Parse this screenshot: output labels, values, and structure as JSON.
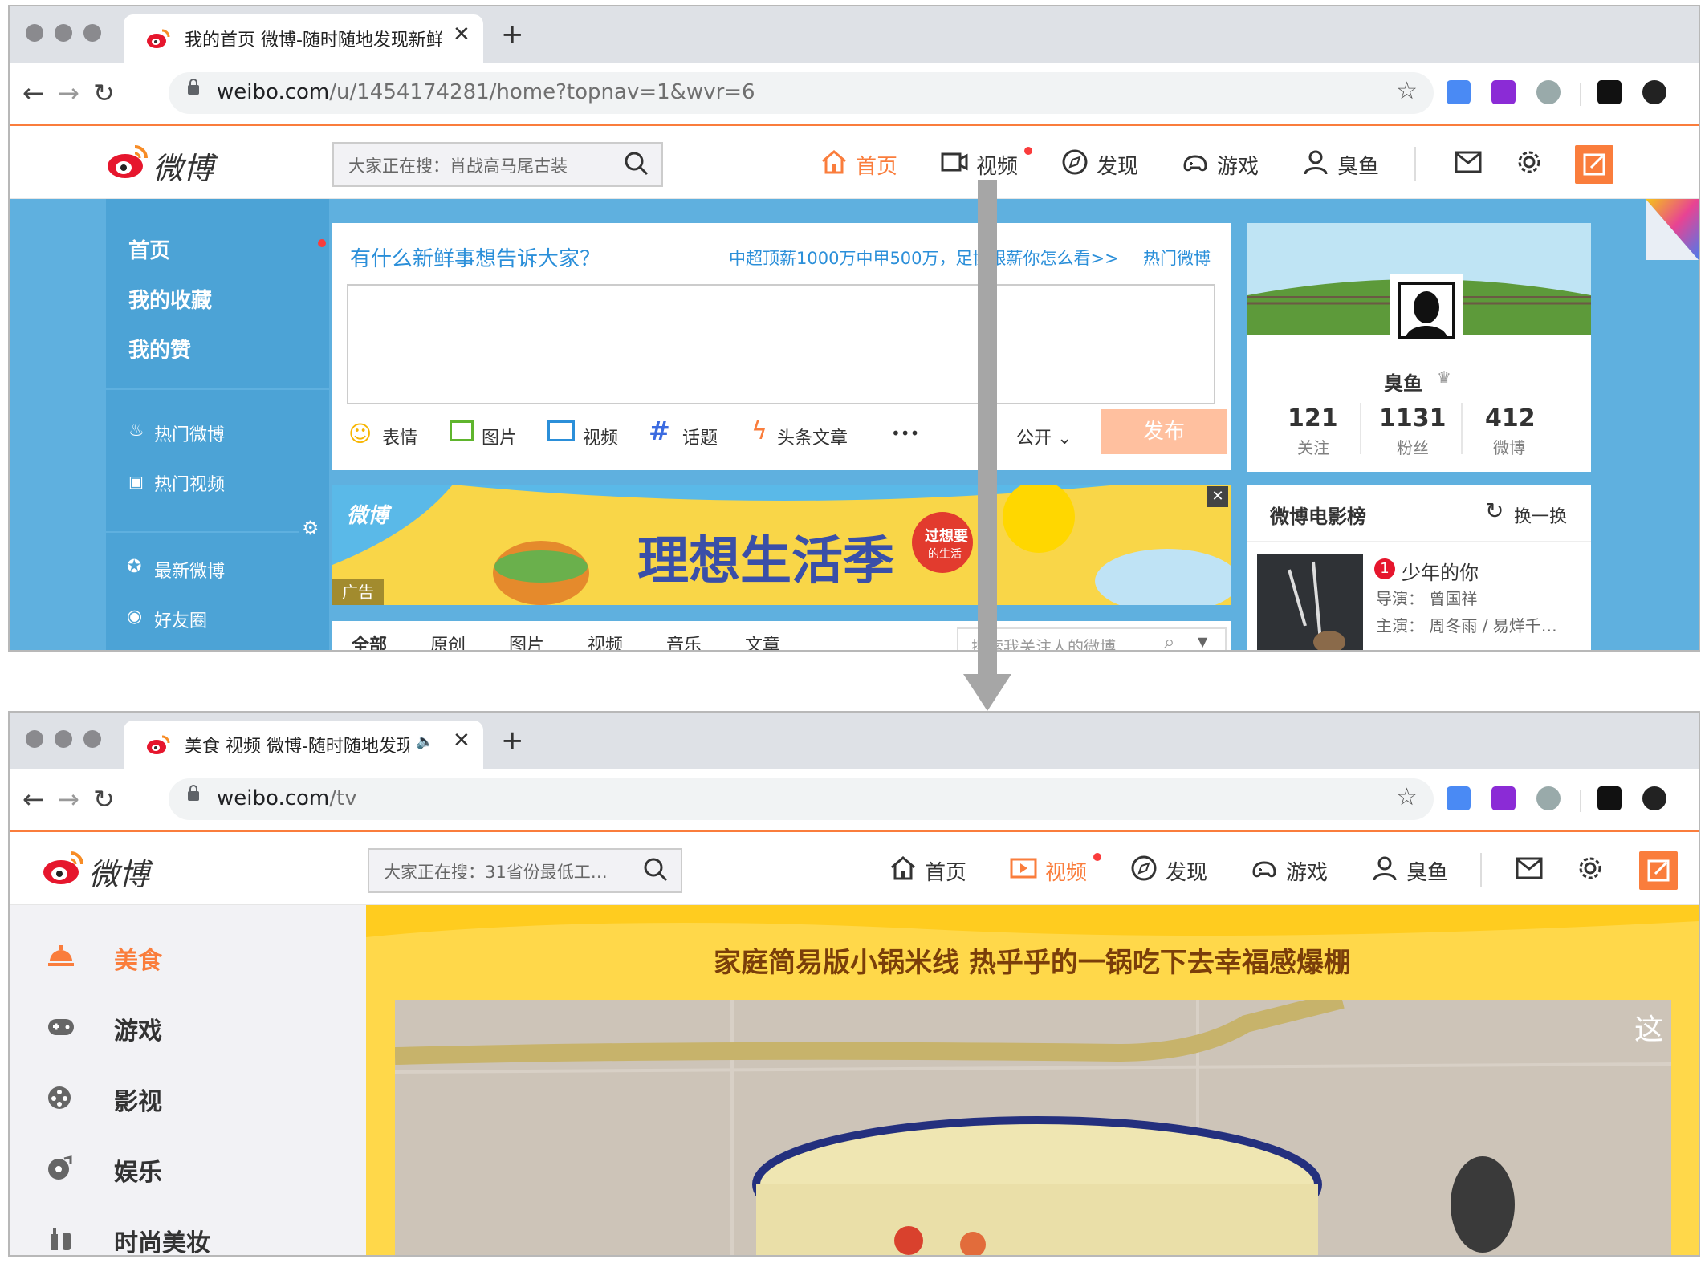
{
  "window1": {
    "tab_title": "我的首页 微博-随时随地发现新鲜事",
    "url_host": "weibo.com",
    "url_path": "/u/1454174281/home?topnav=1&wvr=6",
    "search_placeholder": "大家正在搜：肖战高马尾古装",
    "nav": {
      "home": "首页",
      "video": "视频",
      "discover": "发现",
      "game": "游戏",
      "user": "臭鱼"
    },
    "left_nav": {
      "home": "首页",
      "favorites": "我的收藏",
      "likes": "我的赞",
      "hot_weibo": "热门微博",
      "hot_video": "热门视频",
      "latest": "最新微博",
      "friends": "好友圈"
    },
    "publisher": {
      "prompt": "有什么新鲜事想告诉大家？",
      "hot_link": "中超顶薪1000万中甲500万，足协限薪你怎么看>>",
      "hot_label": "热门微博",
      "tools": [
        "表情",
        "图片",
        "视频",
        "话题",
        "头条文章"
      ],
      "more": "•••",
      "privacy": "公开 ⌄",
      "submit": "发布"
    },
    "ad": {
      "logo": "微博",
      "slogan": "理想生活季",
      "badge_line1": "过想要",
      "badge_line2": "的生活",
      "tag": "广告",
      "close": "✕"
    },
    "feed_tabs": [
      "全部",
      "原创",
      "图片",
      "视频",
      "音乐",
      "文章"
    ],
    "feed_search_placeholder": "搜索我关注人的微博",
    "profile": {
      "name": "臭鱼",
      "stats": [
        {
          "value": "121",
          "label": "关注"
        },
        {
          "value": "1131",
          "label": "粉丝"
        },
        {
          "value": "412",
          "label": "微博"
        }
      ]
    },
    "movies": {
      "title": "微博电影榜",
      "refresh": "换一换",
      "rank": "1",
      "movie_name": "少年的你",
      "director": "导演：  曾国祥",
      "cast": "主演：  周冬雨 / 易烊千…"
    }
  },
  "window2": {
    "tab_title": "美食 视频 微博-随时随地发现",
    "url_host": "weibo.com",
    "url_path": "/tv",
    "search_placeholder": "大家正在搜：31省份最低工…",
    "nav": {
      "home": "首页",
      "video": "视频",
      "discover": "发现",
      "game": "游戏",
      "user": "臭鱼"
    },
    "categories": [
      "美食",
      "游戏",
      "影视",
      "娱乐",
      "时尚美妆"
    ],
    "video_title": "家庭简易版小锅米线 热乎乎的一锅吃下去幸福感爆棚",
    "video_overlay": "这"
  },
  "logo_text": "微博",
  "colors": {
    "accent": "#fa7d3c",
    "weibo_blue": "#4ca3d6",
    "link_blue": "#2b8fd9",
    "ad_yellow": "#ffd84a"
  }
}
